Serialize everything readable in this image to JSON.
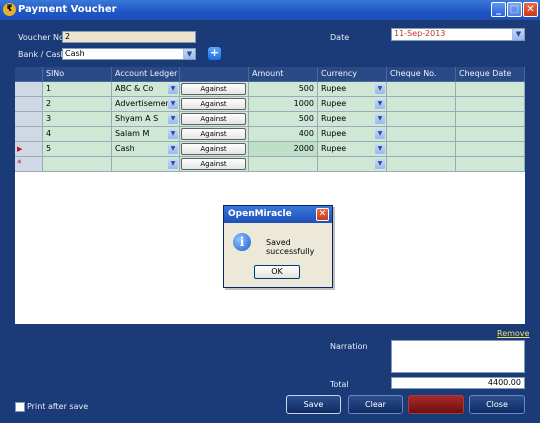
{
  "window": {
    "title": "Payment Voucher",
    "min_glyph": "_",
    "max_glyph": "□",
    "close_glyph": "✕"
  },
  "form": {
    "voucher_no_label": "Voucher No.",
    "voucher_no_value": "2",
    "date_label": "Date",
    "date_value": "11-Sep-2013",
    "bank_cash_label": "Bank / Cash",
    "bank_cash_value": "Cash",
    "add_glyph": "+"
  },
  "grid": {
    "columns": [
      "SlNo",
      "Account Ledger",
      "",
      "Amount",
      "Currency",
      "Cheque No.",
      "Cheque Date"
    ],
    "against_label": "Against",
    "rows": [
      {
        "slno": "1",
        "ledger": "ABC & Co",
        "amount": "500",
        "currency": "Rupee"
      },
      {
        "slno": "2",
        "ledger": "Advertisements",
        "amount": "1000",
        "currency": "Rupee"
      },
      {
        "slno": "3",
        "ledger": "Shyam A S",
        "amount": "500",
        "currency": "Rupee"
      },
      {
        "slno": "4",
        "ledger": "Salam M",
        "amount": "400",
        "currency": "Rupee"
      },
      {
        "slno": "5",
        "ledger": "Cash",
        "amount": "2000",
        "currency": "Rupee"
      }
    ],
    "current_row_marker": "▶",
    "new_row_marker": "*"
  },
  "dialog": {
    "title": "OpenMiracle",
    "message": "Saved successfully",
    "ok_label": "OK",
    "info_glyph": "i",
    "close_glyph": "✕"
  },
  "footer": {
    "remove_label": "Remove",
    "narration_label": "Narration",
    "total_label": "Total",
    "total_value": "4400.00",
    "print_after_save_label": "Print after save",
    "save_label": "Save",
    "clear_label": "Clear",
    "delete_label": "",
    "close_label": "Close"
  },
  "colors": {
    "accent": "#1b3a78",
    "grid_row": "#cfe8d6",
    "grid_header": "#2a4a86",
    "link": "#f0e070"
  }
}
